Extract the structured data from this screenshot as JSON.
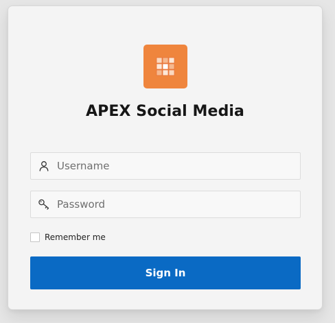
{
  "app": {
    "title": "APEX Social Media",
    "icon": "grid-tiles-icon",
    "icon_color": "#ef853d"
  },
  "login": {
    "username": {
      "placeholder": "Username",
      "value": "",
      "icon": "user-icon"
    },
    "password": {
      "placeholder": "Password",
      "value": "",
      "icon": "key-icon"
    },
    "remember_label": "Remember me",
    "remember_checked": false,
    "signin_label": "Sign In",
    "signin_color": "#0a6ac4"
  }
}
